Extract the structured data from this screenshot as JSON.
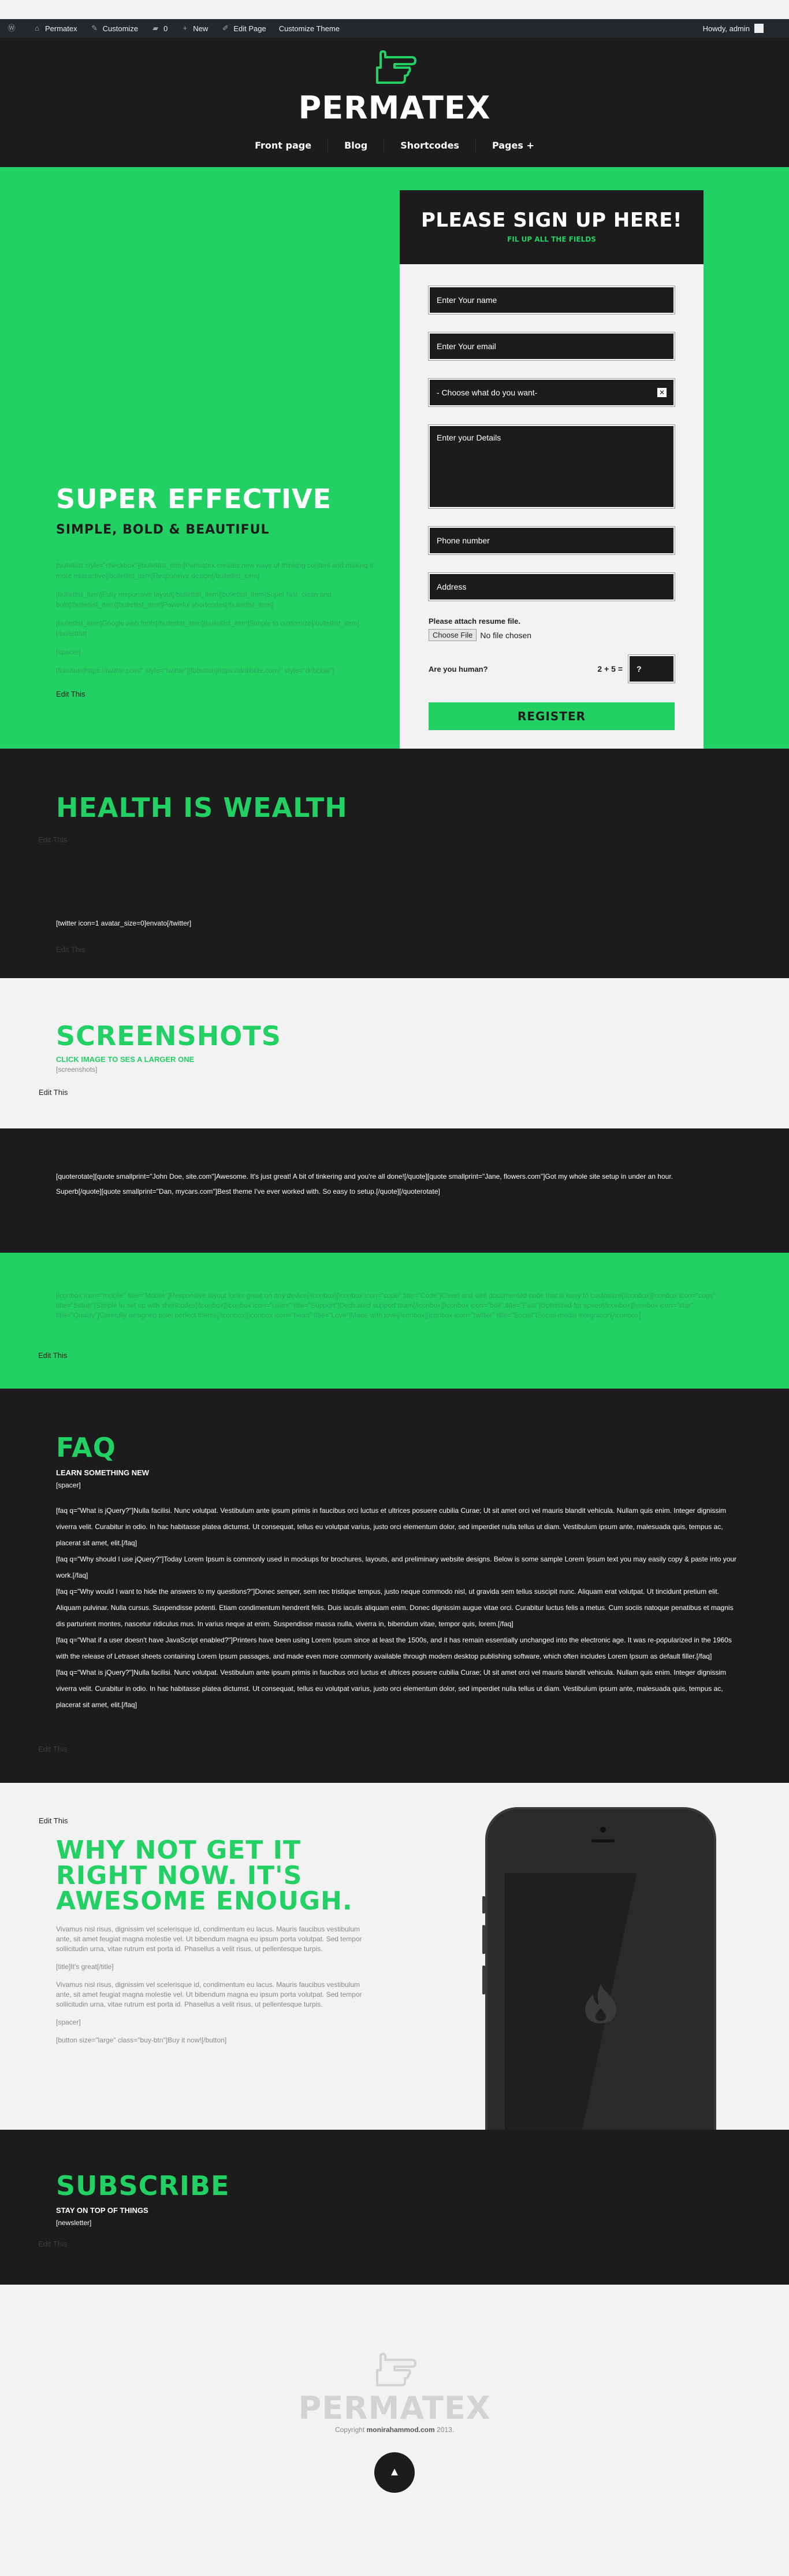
{
  "adminbar": {
    "items": [
      {
        "icon": "wordpress-logo-icon",
        "label": ""
      },
      {
        "icon": "home-icon",
        "label": "Permatex"
      },
      {
        "icon": "brush-icon",
        "label": "Customize"
      },
      {
        "icon": "comment-icon",
        "label": "0"
      },
      {
        "icon": "plus-icon",
        "label": "New"
      },
      {
        "icon": "pencil-icon",
        "label": "Edit Page"
      },
      {
        "icon": "",
        "label": "Customize Theme"
      }
    ],
    "howdy": "Howdy, admin"
  },
  "header": {
    "logo_text": "PERMATEX",
    "nav": [
      "Front page",
      "Blog",
      "Shortcodes",
      "Pages +"
    ]
  },
  "hero": {
    "title": "SUPER EFFECTIVE",
    "subtitle": "SIMPLE, BOLD & BEAUTIFUL",
    "body": [
      "[bulletlist style=\"checkbox\"][bulletlist_item]Permatex creates new ways of thinking content and making it more interactive][bulletlist_item]Responsive design[/bulletlist_item]",
      "[bulletlist_item]Fully responsive layout[/bulletlist_item][bulletlist_item]Super fast, clean and bold[/bulletlist_item][bulletlist_item]Powerful shortcodes[/bulletlist_item]",
      "[bulletlist_item]Google web fonts[/bulletlist_item][bulletlist_item]Simple to customize[/bulletlist_item][/bulletlist]",
      "[spacer]",
      "[fbbutton]https://twitter.com/\" style=\"twitter\"][fbbutton]https://dribbble.com/\" style=\"dribbble\"]"
    ],
    "edit": "Edit This"
  },
  "form": {
    "title": "PLEASE SIGN UP HERE!",
    "tagline": "FIL UP ALL THE FIELDS",
    "name_placeholder": "Enter Your name",
    "email_placeholder": "Enter Your email",
    "choose_placeholder": "- Choose what do you want-",
    "details_placeholder": "Enter your Details",
    "phone_placeholder": "Phone number",
    "address_placeholder": "Address",
    "resume_label": "Please attach resume file.",
    "file_button": "Choose File",
    "file_status": "No file chosen",
    "captcha_label": "Are you human?",
    "captcha_equation": "2 + 5 =",
    "captcha_value": "?",
    "register": "REGISTER"
  },
  "health": {
    "title": "HEALTH IS WEALTH",
    "edit1": "Edit This",
    "twitter": "[twitter icon=1 avatar_size=0]envato[/twitter]",
    "edit2": "Edit This"
  },
  "screenshots": {
    "title": "SCREENSHOTS",
    "subtitle": "CLICK IMAGE TO SES A LARGER ONE",
    "code": "[screenshots]",
    "edit": "Edit This"
  },
  "quotes": {
    "line1": "[quoterotate][quote smallprint=\"John Doe, site.com\"]Awesome. It's just great! A bit of tinkering and you're all done![/quote][quote smallprint=\"Jane, flowers.com\"]Got my whole site setup in under an hour.",
    "line2": "Superb[/quote][quote smallprint=\"Dan, mycars.com\"]Best theme I've ever worked with. So easy to setup.[/quote][/quoterotate]"
  },
  "icons_block": {
    "text": "[iconbox icon=\"mobile\" title=\"Mobile\"]Responsive layout looks great on any device[/iconbox][iconbox icon=\"code\" title=\"Code\"]Clean and well documented code that is easy to customize[/iconbox][iconbox icon=\"cogs\" title=\"Setup\"]Simple to set up with shortcodes[/iconbox][iconbox icon=\"users\" title=\"Support\"]Dedicated support team[/iconbox][iconbox icon=\"bolt\" title=\"Fast\"]Optimized for speed[/iconbox][iconbox icon=\"star\" title=\"Quality\"]Carefully designed pixel perfect theme[/iconbox][iconbox icon=\"heart\" title=\"Love\"]Made with love[/iconbox][iconbox icon=\"twitter\" title=\"Social\"]Social media integration[/iconbox]",
    "edit": "Edit This"
  },
  "faq": {
    "title": "FAQ",
    "subtitle": "LEARN SOMETHING NEW",
    "code": "[spacer]",
    "items": [
      "[faq q=\"What is jQuery?\"]Nulla facilisi. Nunc volutpat. Vestibulum ante ipsum primis in faucibus orci luctus et ultrices posuere cubilia Curae; Ut sit amet orci vel mauris blandit vehicula. Nullam quis enim. Integer dignissim viverra velit. Curabitur in odio. In hac habitasse platea dictumst. Ut consequat, tellus eu volutpat varius, justo orci elementum dolor, sed imperdiet nulla tellus ut diam. Vestibulum ipsum ante, malesuada quis, tempus ac, placerat sit amet, elit.[/faq]",
      "[faq q=\"Why should I use jQuery?\"]Today Lorem Ipsum is commonly used in mockups for brochures, layouts, and preliminary website designs. Below is some sample Lorem Ipsum text you may easily copy & paste into your work.[/faq]",
      "[faq q=\"Why would I want to hide the answers to my questions?\"]Donec semper, sem nec tristique tempus, justo neque commodo nisl, ut gravida sem tellus suscipit nunc. Aliquam erat volutpat. Ut tincidunt pretium elit. Aliquam pulvinar. Nulla cursus. Suspendisse potenti. Etiam condimentum hendrerit felis. Duis iaculis aliquam enim. Donec dignissim augue vitae orci. Curabitur luctus felis a metus. Cum sociis natoque penatibus et magnis dis parturient montes, nascetur ridiculus mus. In varius neque at enim. Suspendisse massa nulla, viverra in, bibendum vitae, tempor quis, lorem.[/faq]",
      "[faq q=\"What if a user doesn't have JavaScript enabled?\"]Printers have been using Lorem Ipsum since at least the 1500s, and it has remain essentially unchanged into the electronic age. It was re-popularized in the 1960s with the release of Letraset sheets containing Lorem Ipsum passages, and made even more commonly available through modern desktop publishing software, which often includes Lorem Ipsum as default filler.[/faq]",
      "[faq q=\"What is jQuery?\"]Nulla facilisi. Nunc volutpat. Vestibulum ante ipsum primis in faucibus orci luctus et ultrices posuere cubilia Curae; Ut sit amet orci vel mauris blandit vehicula. Nullam quis enim. Integer dignissim viverra velit. Curabitur in odio. In hac habitasse platea dictumst. Ut consequat, tellus eu volutpat varius, justo orci elementum dolor, sed imperdiet nulla tellus ut diam. Vestibulum ipsum ante, malesuada quis, tempus ac, placerat sit amet, elit.[/faq]"
    ],
    "edit": "Edit This"
  },
  "why": {
    "edit": "Edit This",
    "title": "WHY NOT GET IT RIGHT NOW. IT'S AWESOME ENOUGH.",
    "para1": "Vivamus nisl risus, dignissim vel scelerisque id, condimentum eu lacus. Mauris faucibus vestibulum ante, sit amet feugiat magna molestie vel. Ut bibendum magna eu ipsum porta volutpat. Sed tempor sollicitudin urna, vitae rutrum est porta id. Phasellus a velit risus, ut pellentesque turpis.",
    "code1": "[title]It's great[/title]",
    "para2": "Vivamus nisl risus, dignissim vel scelerisque id, condimentum eu lacus. Mauris faucibus vestibulum ante, sit amet feugiat magna molestie vel. Ut bibendum magna eu ipsum porta volutpat. Sed tempor sollicitudin urna, vitae rutrum est porta id. Phasellus a velit risus, ut pellentesque turpis.",
    "code2": "[spacer]",
    "code3": "[button size=\"large\" class=\"buy-btn\"]Buy it now![/button]"
  },
  "subscribe": {
    "title": "SUBSCRIBE",
    "subtitle": "STAY ON TOP OF THINGS",
    "code": "[newsletter]",
    "edit": "Edit This"
  },
  "footer": {
    "logo_text": "PERMATEX",
    "copy_prefix": "Copyright",
    "copy_author": "monirahammod.com",
    "copy_year": "2013.",
    "totop": "▲"
  },
  "colors": {
    "accent": "#22d064",
    "dark": "#1c1c1c",
    "light": "#f2f2f2"
  }
}
